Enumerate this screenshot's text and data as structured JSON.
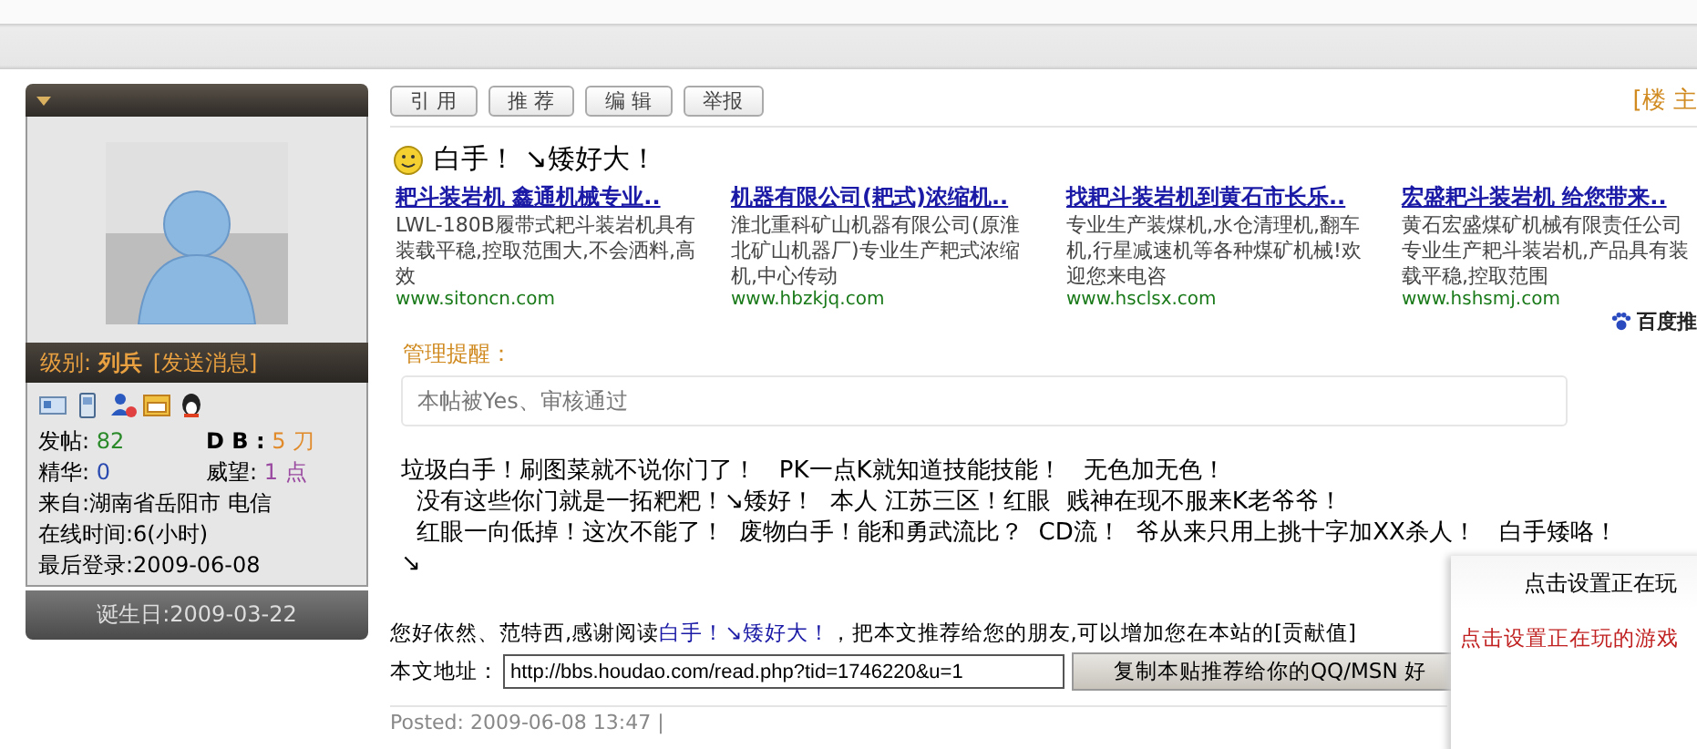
{
  "profile": {
    "level_label": "级别:",
    "level": "列兵",
    "send_message": "[发送消息]",
    "stats": [
      {
        "label": "发帖:",
        "value": "82",
        "color": "#2a8a2a"
      },
      {
        "label": "D B :",
        "value": "5 刀",
        "color": "#e08a2a"
      },
      {
        "label": "精华:",
        "value": "0",
        "color": "#2a4ab0"
      },
      {
        "label": "威望:",
        "value": "1 点",
        "color": "#9a4aa0"
      }
    ],
    "details": [
      "来自:湖南省岳阳市 电信",
      "在线时间:6(小时)",
      "最后登录:2009-06-08"
    ],
    "birthday": "诞生日:2009-03-22"
  },
  "actions": [
    "引 用",
    "推 荐",
    "编 辑",
    "举报"
  ],
  "floor": "[楼 主",
  "post_title": "白手！ ↘矮好大！",
  "ads": [
    {
      "title": "耙斗装岩机  鑫通机械专业..",
      "text": [
        "LWL-180B履带式耙斗装岩机具有",
        "装载平稳,控取范围大,不会洒料,高",
        "效"
      ],
      "url": "www.sitoncn.com"
    },
    {
      "title": "机器有限公司(耙式)浓缩机..",
      "text": [
        "淮北重科矿山机器有限公司(原淮",
        "北矿山机器厂)专业生产耙式浓缩",
        "机,中心传动"
      ],
      "url": "www.hbzkjq.com"
    },
    {
      "title": "找耙斗装岩机到黄石市长乐..",
      "text": [
        "专业生产装煤机,水仓清理机,翻车",
        "机,行星减速机等各种煤矿机械!欢",
        "迎您来电咨"
      ],
      "url": "www.hsclsx.com"
    },
    {
      "title": "宏盛耙斗装岩机  给您带来..",
      "text": [
        "黄石宏盛煤矿机械有限责任公司",
        "专业生产耙斗装岩机,产品具有装",
        "载平稳,控取范围"
      ],
      "url": "www.hshsmj.com"
    }
  ],
  "ad_brand": "百度推",
  "notice": {
    "label": "管理提醒：",
    "text": "本帖被Yes、审核通过"
  },
  "body": [
    "垃圾白手！刷图菜就不说你门了！   PK一点K就知道技能技能！   无色加无色！",
    "  没有这些你门就是一拓粑粑！↘矮好！  本人 江苏三区！红眼  贱神在现不服来K老爷爷！",
    "  红眼一向低掉！这次不能了！  废物白手！能和勇武流比？  CD流！  爷从来只用上挑十字加XX杀人！   白手矮咯！",
    "↘"
  ],
  "recommend": {
    "before": "您好依然、范特西,感谢阅读",
    "link": "白手！↘矮好大！",
    "after": "，把本文推荐给您的朋友,可以增加您在本站的[贡献值]"
  },
  "address": {
    "label": "本文地址：",
    "value": "http://bbs.houdao.com/read.php?tid=1746220&u=1",
    "copy_button": "复制本贴推荐给你的QQ/MSN 好"
  },
  "posted": "Posted: 2009-06-08 13:47 |",
  "game_popup": {
    "title": "点击设置正在玩",
    "link": "点击设置正在玩的游戏"
  }
}
